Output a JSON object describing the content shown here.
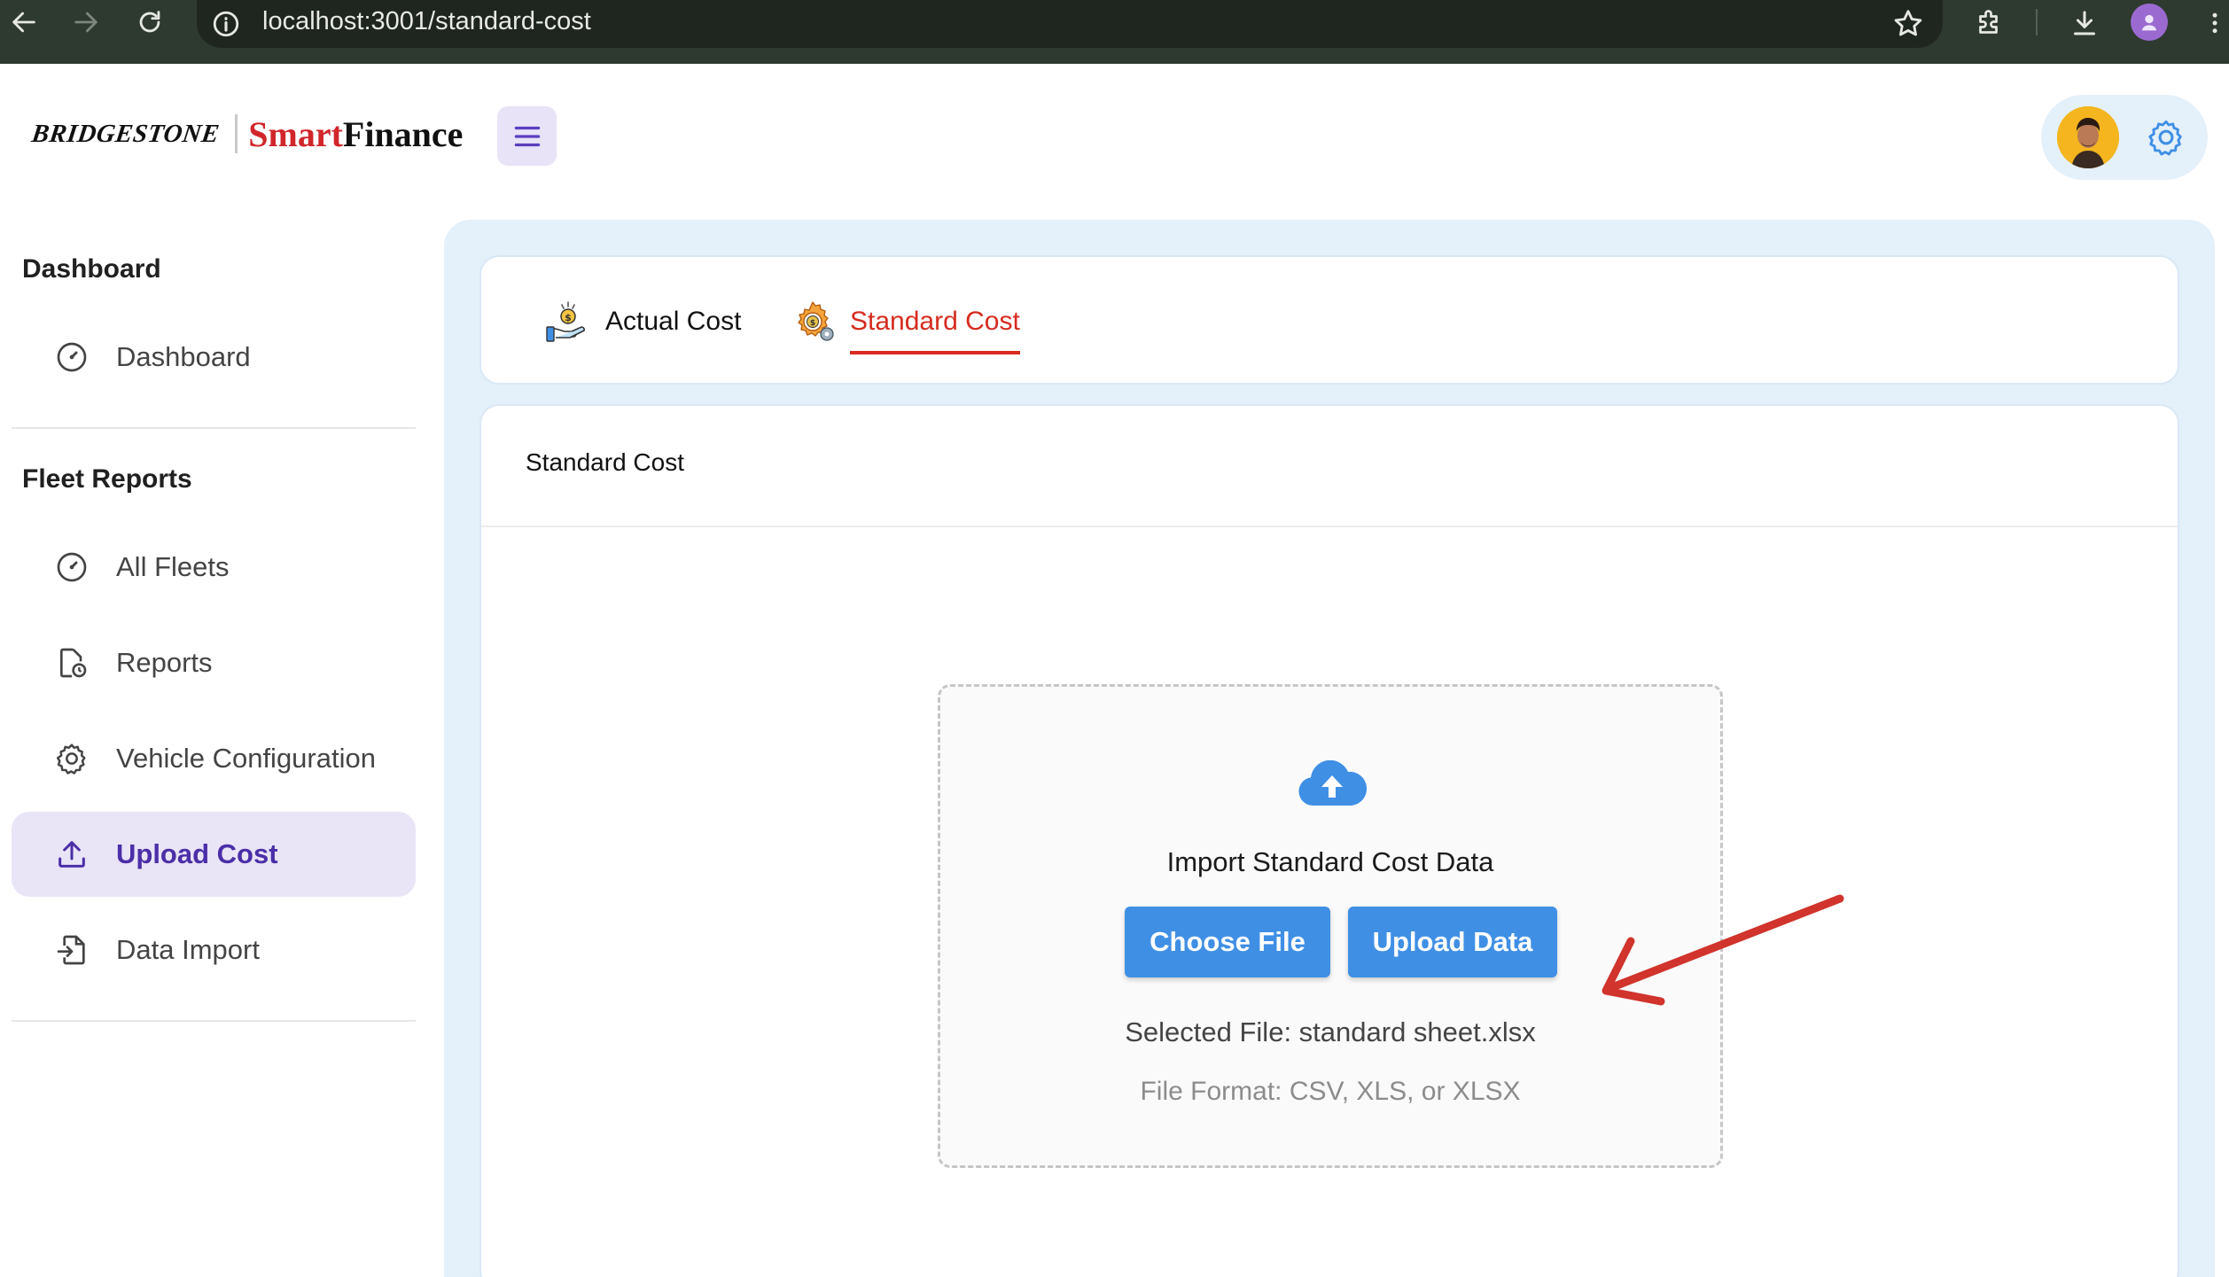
{
  "browser": {
    "url": "localhost:3001/standard-cost"
  },
  "header": {
    "brand_parent": "BRIDGESTONE",
    "brand_smart": "Smart",
    "brand_finance": "Finance"
  },
  "sidebar": {
    "sections": [
      {
        "title": "Dashboard",
        "items": [
          {
            "label": "Dashboard",
            "icon": "speedometer-icon"
          }
        ]
      },
      {
        "title": "Fleet Reports",
        "items": [
          {
            "label": "All Fleets",
            "icon": "speedometer-icon"
          },
          {
            "label": "Reports",
            "icon": "report-clock-icon"
          },
          {
            "label": "Vehicle Configuration",
            "icon": "gear-icon"
          },
          {
            "label": "Upload Cost",
            "icon": "upload-icon",
            "active": true
          },
          {
            "label": "Data Import",
            "icon": "file-import-icon"
          }
        ]
      }
    ]
  },
  "tabs": [
    {
      "label": "Actual Cost",
      "icon": "money-hand-icon"
    },
    {
      "label": "Standard Cost",
      "icon": "gear-dollar-icon",
      "selected": true
    }
  ],
  "card": {
    "title": "Standard Cost"
  },
  "upload": {
    "title": "Import Standard Cost Data",
    "choose_label": "Choose File",
    "upload_label": "Upload Data",
    "selected_file": "Selected File: standard sheet.xlsx",
    "format_hint": "File Format: CSV, XLS, or XLSX"
  },
  "colors": {
    "accent_blue": "#3f8fe5",
    "active_tab_red": "#d62b1e",
    "active_sidebar_bg": "#e9e4f6",
    "active_sidebar_text": "#4b2ea8",
    "panel_bg": "#e4f0fa"
  }
}
